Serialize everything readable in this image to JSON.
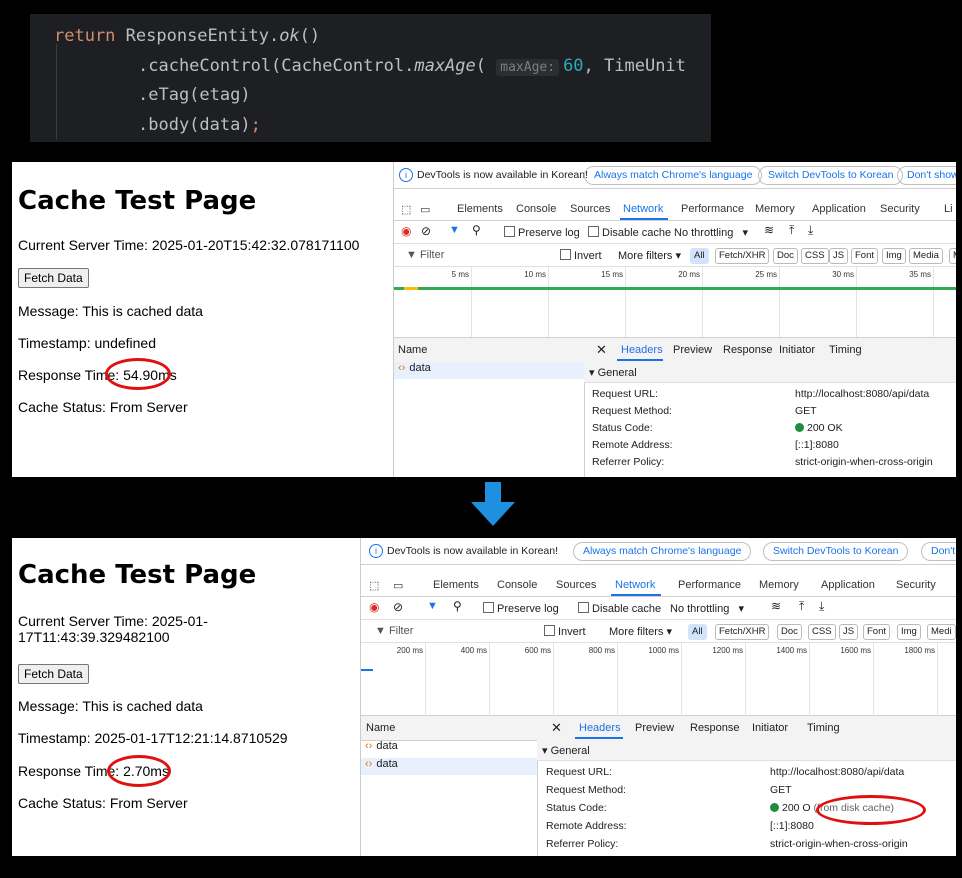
{
  "code": {
    "line1_kw": "return",
    "line1_rest": " ResponseEntity.",
    "line1_ok": "ok",
    "line1_end": "()",
    "line2_a": ".cacheControl(CacheControl.",
    "line2_method": "maxAge",
    "line2_paren": "(",
    "line2_hint": "maxAge:",
    "line2_num": "60",
    "line2_rest": ", TimeUnit",
    "line3": ".eTag(etag)",
    "line4_a": ".body(data)",
    "line4_semi": ";"
  },
  "top_page": {
    "title": "Cache Test Page",
    "server_time": "Current Server Time: 2025-01-20T15:42:32.078171100",
    "button": "Fetch Data",
    "message": "Message: This is cached data",
    "timestamp": "Timestamp: undefined",
    "response_label": "Response Time:",
    "response_value": "54.90ms",
    "cache_status": "Cache Status: From Server"
  },
  "bottom_page": {
    "title": "Cache Test Page",
    "server_time_1": "Current Server Time: 2025-01-",
    "server_time_2": "17T11:43:39.329482100",
    "button": "Fetch Data",
    "message": "Message: This is cached data",
    "timestamp": "Timestamp: 2025-01-17T12:21:14.8710529",
    "response_label": "Response Time:",
    "response_value": "2.70ms",
    "cache_status": "Cache Status: From Server"
  },
  "devtools": {
    "info": "DevTools is now available in Korean!",
    "btn_match": "Always match Chrome's language",
    "btn_switch": "Switch DevTools to Korean",
    "btn_dont_top": "Don't show",
    "btn_dont_bottom": "Don't",
    "tabs": [
      "Elements",
      "Console",
      "Sources",
      "Network",
      "Performance",
      "Memory",
      "Application",
      "Security",
      "Li"
    ],
    "preserve_log": "Preserve log",
    "disable_cache": "Disable cache",
    "throttling": "No throttling",
    "filter": "Filter",
    "invert": "Invert",
    "more_filters": "More filters",
    "chips_top": [
      "All",
      "Fetch/XHR",
      "Doc",
      "CSS",
      "JS",
      "Font",
      "Img",
      "Media",
      "M"
    ],
    "chips_bottom": [
      "All",
      "Fetch/XHR",
      "Doc",
      "CSS",
      "JS",
      "Font",
      "Img",
      "Medi"
    ],
    "ticks_top": [
      "5 ms",
      "10 ms",
      "15 ms",
      "20 ms",
      "25 ms",
      "30 ms",
      "35 ms"
    ],
    "ticks_bottom": [
      "200 ms",
      "400 ms",
      "600 ms",
      "800 ms",
      "1000 ms",
      "1200 ms",
      "1400 ms",
      "1600 ms",
      "1800 ms"
    ],
    "name_header": "Name",
    "detail_tabs": [
      "Headers",
      "Preview",
      "Response",
      "Initiator",
      "Timing"
    ],
    "request_name": "data",
    "general": "General",
    "keys": [
      "Request URL:",
      "Request Method:",
      "Status Code:",
      "Remote Address:",
      "Referrer Policy:"
    ],
    "url": "http://localhost:8080/api/data",
    "method": "GET",
    "status": "200 OK",
    "status_bottom": "200 O",
    "from_cache": "(from disk cache)",
    "remote": "[::1]:8080",
    "policy": "strict-origin-when-cross-origin"
  },
  "colors": {
    "arrow": "#1f8fe0",
    "oval": "#e01010",
    "accent": "#1a73e8"
  }
}
